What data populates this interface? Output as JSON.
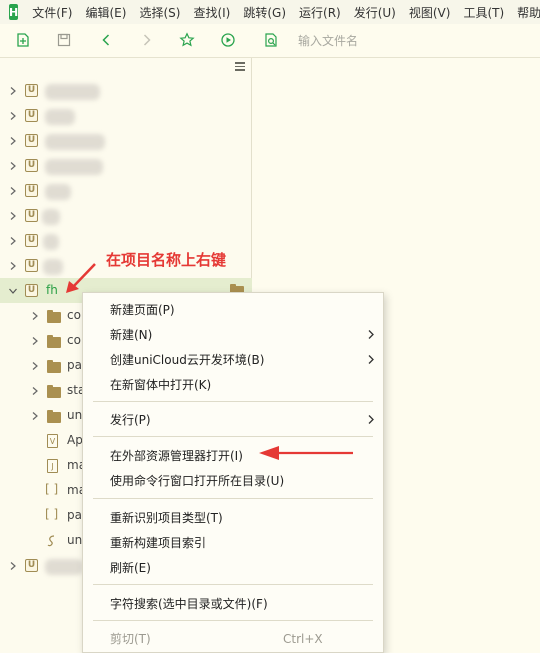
{
  "menubar": {
    "logo": "H",
    "items": [
      "文件(F)",
      "编辑(E)",
      "选择(S)",
      "查找(I)",
      "跳转(G)",
      "运行(R)",
      "发行(U)",
      "视图(V)",
      "工具(T)",
      "帮助"
    ]
  },
  "toolbar": {
    "search_placeholder": "输入文件名"
  },
  "tree": {
    "selected_project": "fh",
    "children": [
      "co",
      "co",
      "pa",
      "sta",
      "un",
      "Ap",
      "ma",
      "ma",
      "pa",
      "uni"
    ]
  },
  "annotation": {
    "text": "在项目名称上右键",
    "color": "#e53935"
  },
  "context_menu": {
    "items": [
      {
        "label": "新建页面(P)"
      },
      {
        "label": "新建(N)"
      },
      {
        "label": "创建uniCloud云开发环境(B)"
      },
      {
        "label": "在新窗体中打开(K)"
      },
      {
        "label": "发行(P)"
      },
      {
        "label": "在外部资源管理器打开(I)"
      },
      {
        "label": "使用命令行窗口打开所在目录(U)"
      },
      {
        "label": "重新识别项目类型(T)"
      },
      {
        "label": "重新构建项目索引"
      },
      {
        "label": "刷新(E)"
      },
      {
        "label": "字符搜索(选中目录或文件)(F)"
      },
      {
        "label": "剪切(T)",
        "shortcut": "Ctrl+X"
      }
    ]
  },
  "colors": {
    "accent_green": "#2aa44e",
    "annotation_red": "#e53935",
    "selected_row": "#e5edcf",
    "background": "#fefcee"
  }
}
